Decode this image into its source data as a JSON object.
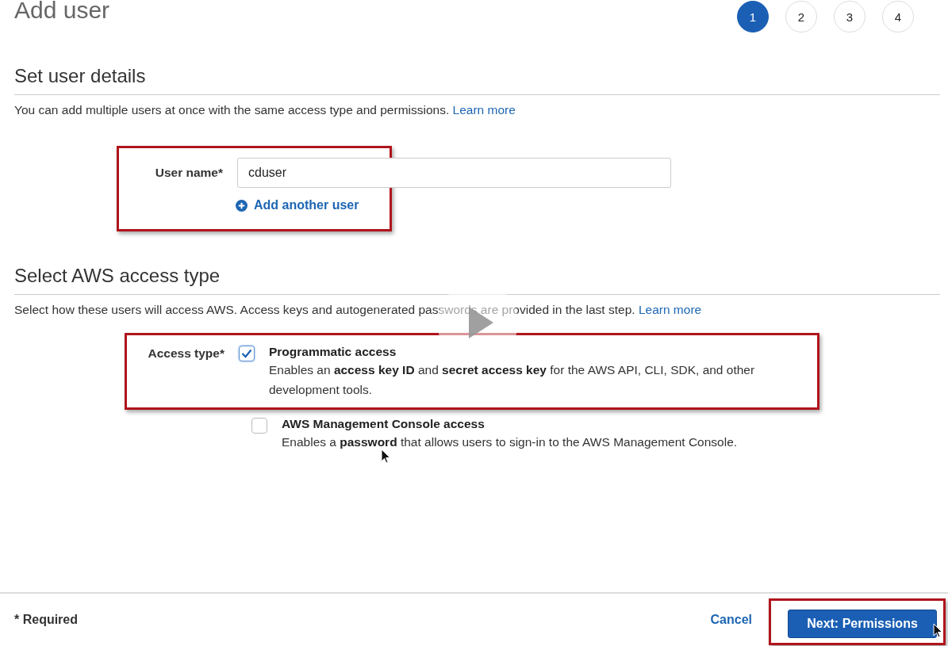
{
  "page_title": "Add user",
  "steps": [
    {
      "label": "1",
      "selected": true
    },
    {
      "label": "2",
      "selected": false
    },
    {
      "label": "3",
      "selected": false
    },
    {
      "label": "4",
      "selected": false
    }
  ],
  "user_details": {
    "heading": "Set user details",
    "description": "You can add multiple users at once with the same access type and permissions.",
    "link": "Learn more",
    "field_label": "User name*",
    "field_value": "cduser",
    "add_link": "Add another user"
  },
  "access": {
    "heading": "Select AWS access type",
    "description": "Select how these users will access AWS. Access keys and autogenerated passwords are provided in the last step.",
    "link": "Learn more",
    "label": "Access type*",
    "options": [
      {
        "title": "Programmatic access",
        "description": "Enables an **access key ID** and **secret access key** for the AWS API, CLI, SDK, and other development tools.",
        "checked": true
      },
      {
        "title": "AWS Management Console access",
        "description": "Enables a **password** that allows users to sign-in to the AWS Management Console.",
        "checked": false
      }
    ]
  },
  "footer": {
    "note": "* Required",
    "cancel": "Cancel",
    "next": "Next: Permissions"
  }
}
